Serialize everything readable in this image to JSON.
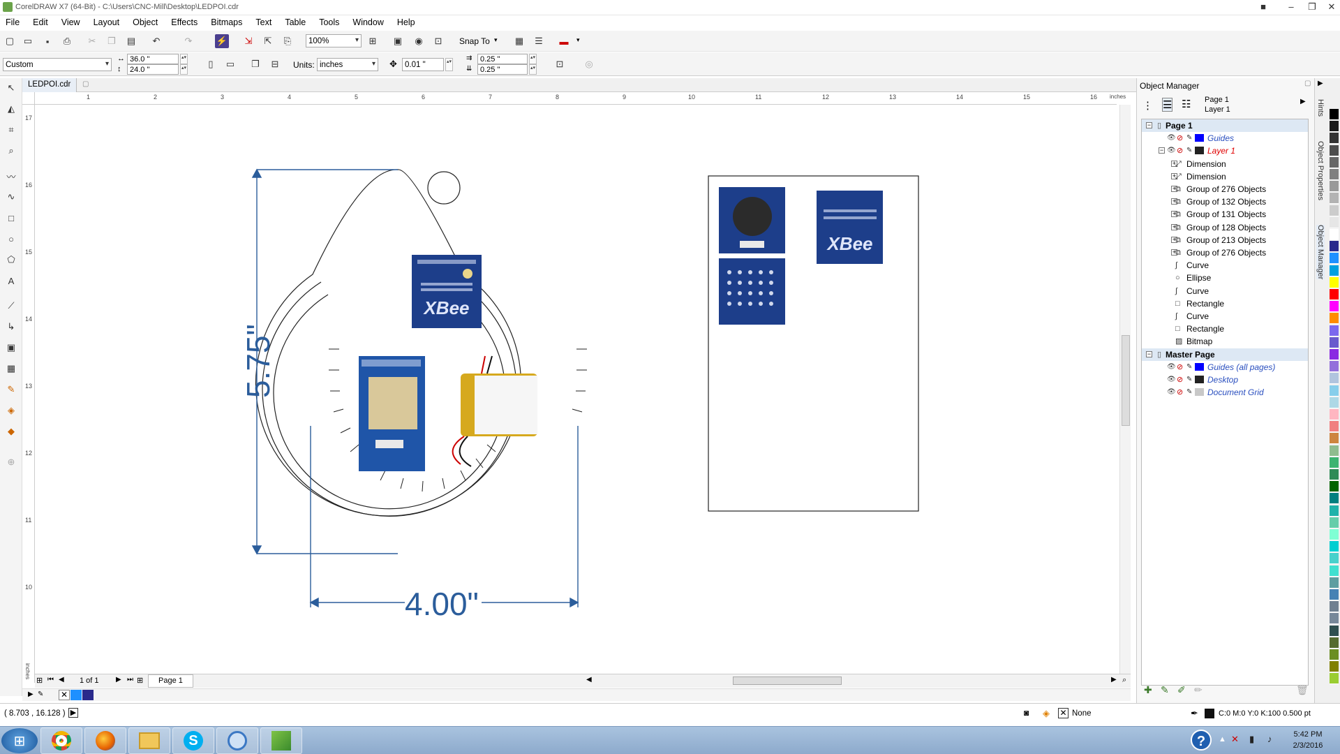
{
  "window": {
    "title": "CorelDRAW X7 (64-Bit) - C:\\Users\\CNC-Mill\\Desktop\\LEDPOI.cdr"
  },
  "menu": [
    "File",
    "Edit",
    "View",
    "Layout",
    "Object",
    "Effects",
    "Bitmaps",
    "Text",
    "Table",
    "Tools",
    "Window",
    "Help"
  ],
  "toolbar": {
    "zoom_value": "100%",
    "snap_to_label": "Snap To"
  },
  "property_bar": {
    "page_preset": "Custom",
    "width": "36.0 \"",
    "height": "24.0 \"",
    "units_label": "Units:",
    "units_value": "inches",
    "nudge": "0.01 \"",
    "dup_x": "0.25 \"",
    "dup_y": "0.25 \""
  },
  "document_tab": "LEDPOI.cdr",
  "ruler": {
    "h_unit": "inches",
    "v_unit": "inches",
    "h_ticks": [
      "1",
      "2",
      "3",
      "4",
      "5",
      "6",
      "7",
      "8",
      "9",
      "10",
      "11",
      "12",
      "13",
      "14",
      "15",
      "16"
    ],
    "v_ticks": [
      "17",
      "16",
      "15",
      "14",
      "13",
      "12",
      "11",
      "10"
    ]
  },
  "drawing": {
    "dim_vertical": "5.75\"",
    "dim_horizontal": "4.00\"",
    "xbee_text": "XBee"
  },
  "page_nav": {
    "page_count": "1 of 1",
    "page_tab": "Page 1"
  },
  "status": {
    "cursor_coords": "( 8.703 , 16.128 )",
    "fill_label": "None",
    "outline_info": "C:0 M:0 Y:0 K:100  0.500 pt"
  },
  "taskbar": {
    "time": "5:42 PM",
    "date": "2/3/2016"
  },
  "object_manager": {
    "title": "Object Manager",
    "current_page": "Page 1",
    "current_layer": "Layer 1",
    "tree": [
      {
        "label": "Page 1",
        "level": 0,
        "bold": true,
        "expand": "⊟",
        "selected": true
      },
      {
        "label": "Guides",
        "level": 1,
        "italic": true,
        "color": "#2a4fbf",
        "swatch": "#0000ff"
      },
      {
        "label": "Layer 1",
        "level": 1,
        "italic": true,
        "color": "#e00000",
        "swatch": "#222222",
        "expand": "⊟"
      },
      {
        "label": "Dimension",
        "level": 2,
        "expand": "⊞"
      },
      {
        "label": "Dimension",
        "level": 2,
        "expand": "⊞"
      },
      {
        "label": "Group of 276 Objects",
        "level": 2,
        "expand": "⊞"
      },
      {
        "label": "Group of 132 Objects",
        "level": 2,
        "expand": "⊞"
      },
      {
        "label": "Group of 131 Objects",
        "level": 2,
        "expand": "⊞"
      },
      {
        "label": "Group of 128 Objects",
        "level": 2,
        "expand": "⊞"
      },
      {
        "label": "Group of 213 Objects",
        "level": 2,
        "expand": "⊞"
      },
      {
        "label": "Group of 276 Objects",
        "level": 2,
        "expand": "⊞"
      },
      {
        "label": "Curve",
        "level": 2
      },
      {
        "label": "Ellipse",
        "level": 2
      },
      {
        "label": "Curve",
        "level": 2
      },
      {
        "label": "Rectangle",
        "level": 2
      },
      {
        "label": "Curve",
        "level": 2
      },
      {
        "label": "Rectangle",
        "level": 2
      },
      {
        "label": "Bitmap",
        "level": 2
      },
      {
        "label": "Master Page",
        "level": 0,
        "bold": true,
        "expand": "⊟",
        "selected": true
      },
      {
        "label": "Guides (all pages)",
        "level": 1,
        "italic": true,
        "color": "#2a4fbf",
        "swatch": "#0000ff"
      },
      {
        "label": "Desktop",
        "level": 1,
        "italic": true,
        "color": "#2a4fbf",
        "swatch": "#222222"
      },
      {
        "label": "Document Grid",
        "level": 1,
        "italic": true,
        "color": "#2a4fbf",
        "swatch": "#c8c8c8"
      }
    ]
  },
  "dockers": [
    "Hints",
    "Object Properties",
    "Object Manager"
  ],
  "palette": [
    "#000000",
    "#1a1a1a",
    "#333333",
    "#4d4d4d",
    "#666666",
    "#808080",
    "#999999",
    "#b3b3b3",
    "#cccccc",
    "#e6e6e6",
    "#ffffff",
    "#2a2a8c",
    "#1e90ff",
    "#00a0e0",
    "#ffff00",
    "#ff0000",
    "#ff00ff",
    "#ff8c00",
    "#7b68ee",
    "#6a5acd",
    "#8a2be2",
    "#9370db",
    "#b0c4de",
    "#87ceeb",
    "#add8e6",
    "#ffb6c1",
    "#f08080",
    "#cd853f",
    "#8fbc8f",
    "#3cb371",
    "#2e8b57",
    "#006400",
    "#008080",
    "#20b2aa",
    "#66cdaa",
    "#7fffd4",
    "#00ced1",
    "#48d1cc",
    "#40e0d0",
    "#5f9ea0",
    "#4682b4",
    "#708090",
    "#778899",
    "#2f4f4f",
    "#556b2f",
    "#6b8e23",
    "#808000",
    "#9acd32"
  ]
}
